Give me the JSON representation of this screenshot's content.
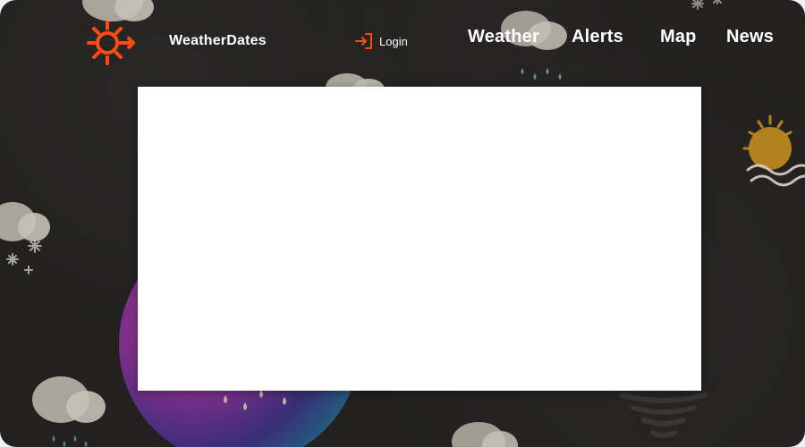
{
  "header": {
    "brand": "WeatherDates",
    "login_label": "Login",
    "nav": [
      {
        "label": "Weather"
      },
      {
        "label": "Alerts"
      },
      {
        "label": "Map"
      },
      {
        "label": "News"
      }
    ]
  },
  "colors": {
    "background": "#222120",
    "accent": "#ff4a12",
    "cloud": "#b9b2a7",
    "rain": "#7f99a0",
    "modal": "#ffffff"
  },
  "icons": {
    "logo": "sun-arrow-icon",
    "login": "login-icon"
  }
}
